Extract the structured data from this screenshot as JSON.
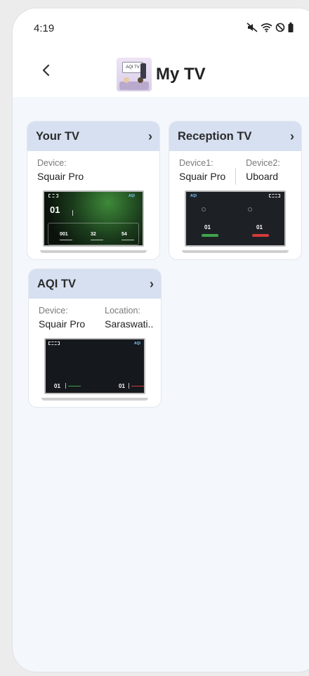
{
  "status": {
    "time": "4:19"
  },
  "header": {
    "title": "My TV",
    "logo_text": "AQI TV"
  },
  "cards": [
    {
      "title": "Your TV",
      "fields": [
        {
          "label": "Device:",
          "value": "Squair Pro"
        }
      ]
    },
    {
      "title": "Reception TV",
      "fields": [
        {
          "label": "Device1:",
          "value": "Squair Pro"
        },
        {
          "label": "Device2:",
          "value": "Uboard"
        }
      ]
    },
    {
      "title": "AQI TV",
      "fields": [
        {
          "label": "Device:",
          "value": "Squair Pro"
        },
        {
          "label": "Location:",
          "value": "Saraswati.."
        }
      ]
    }
  ],
  "screens": {
    "your_tv": {
      "main_value": "01",
      "pollutants": [
        "001",
        "32",
        "54"
      ]
    },
    "reception_tv": {
      "left_value": "01",
      "right_value": "01"
    },
    "aqi_tv": {
      "left_value": "01",
      "right_value": "01"
    }
  },
  "colors": {
    "header_band": "#d7e0f1",
    "background": "#f4f7fb",
    "accent_green": "#3fa34d",
    "accent_red": "#d33a3a"
  }
}
